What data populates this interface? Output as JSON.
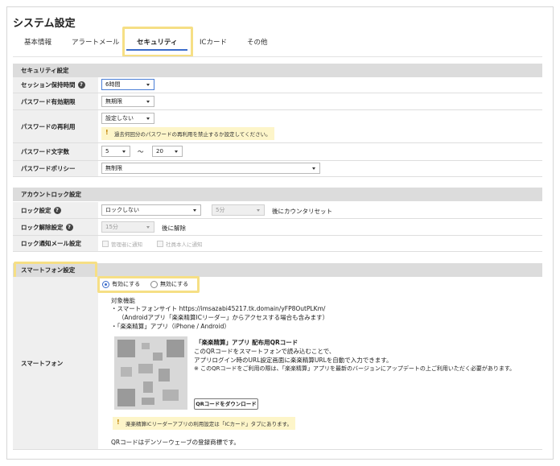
{
  "page": {
    "title": "システム設定"
  },
  "tabs": [
    {
      "label": "基本情報"
    },
    {
      "label": "アラートメール"
    },
    {
      "label": "セキュリティ"
    },
    {
      "label": "ICカード"
    },
    {
      "label": "その他"
    }
  ],
  "security": {
    "header": "セキュリティ設定",
    "session": {
      "label": "セッション保持時間",
      "value": "6時間"
    },
    "password_expiry": {
      "label": "パスワード有効期限",
      "value": "無期限"
    },
    "password_reuse": {
      "label": "パスワードの再利用",
      "value": "設定しない",
      "warning": "過去何回分のパスワードの再利用を禁止するか設定してください。"
    },
    "password_length": {
      "label": "パスワード文字数",
      "min": "5",
      "separator": "～",
      "max": "20"
    },
    "password_policy": {
      "label": "パスワードポリシー",
      "value": "無制限"
    }
  },
  "account_lock": {
    "header": "アカウントロック設定",
    "lock": {
      "label": "ロック設定",
      "value": "ロックしない",
      "minutes": "5分",
      "suffix": "後にカウンタリセット"
    },
    "unlock": {
      "label": "ロック解除設定",
      "minutes": "15分",
      "suffix": "後に解除"
    },
    "notify": {
      "label": "ロック通知メール設定",
      "option1": "管理者に通知",
      "option2": "社員本人に通知"
    }
  },
  "smartphone": {
    "header": "スマートフォン設定",
    "label": "スマートフォン",
    "enable_label": "有効にする",
    "disable_label": "無効にする",
    "target_title": "対象機能",
    "line1": "・スマートフォンサイト https://imsazabi45217.tk.domain/yFP8OutPLKm/",
    "line2": "（Androidアプリ「楽楽精算ICリーダー」からアクセスする場合も含みます）",
    "line3": "・「楽楽精算」アプリ（iPhone / Android）",
    "qr_title": "「楽楽精算」アプリ 配布用QRコード",
    "qr_desc1": "このQRコードをスマートフォンで読み込むことで、",
    "qr_desc2": "アプリログイン時のURL設定画面に楽楽精算URLを自動で入力できます。",
    "qr_desc3": "※ このQRコードをご利用の際は、「楽楽精算」アプリを最新のバージョンにアップデートの上ご利用いただく必要があります。",
    "download_label": "QRコードをダウンロード",
    "ic_note": "楽楽精算ICリーダーアプリの利用設定は「ICカード」タブにあります。",
    "trademark": "QRコードはデンソーウェーブの登録商標です。"
  },
  "colors": {
    "accent": "#3b6ccb",
    "highlight": "#f6df85",
    "section_bg": "#dcdcdc",
    "label_bg": "#efefef",
    "warning_bg": "#fdf5c9"
  }
}
